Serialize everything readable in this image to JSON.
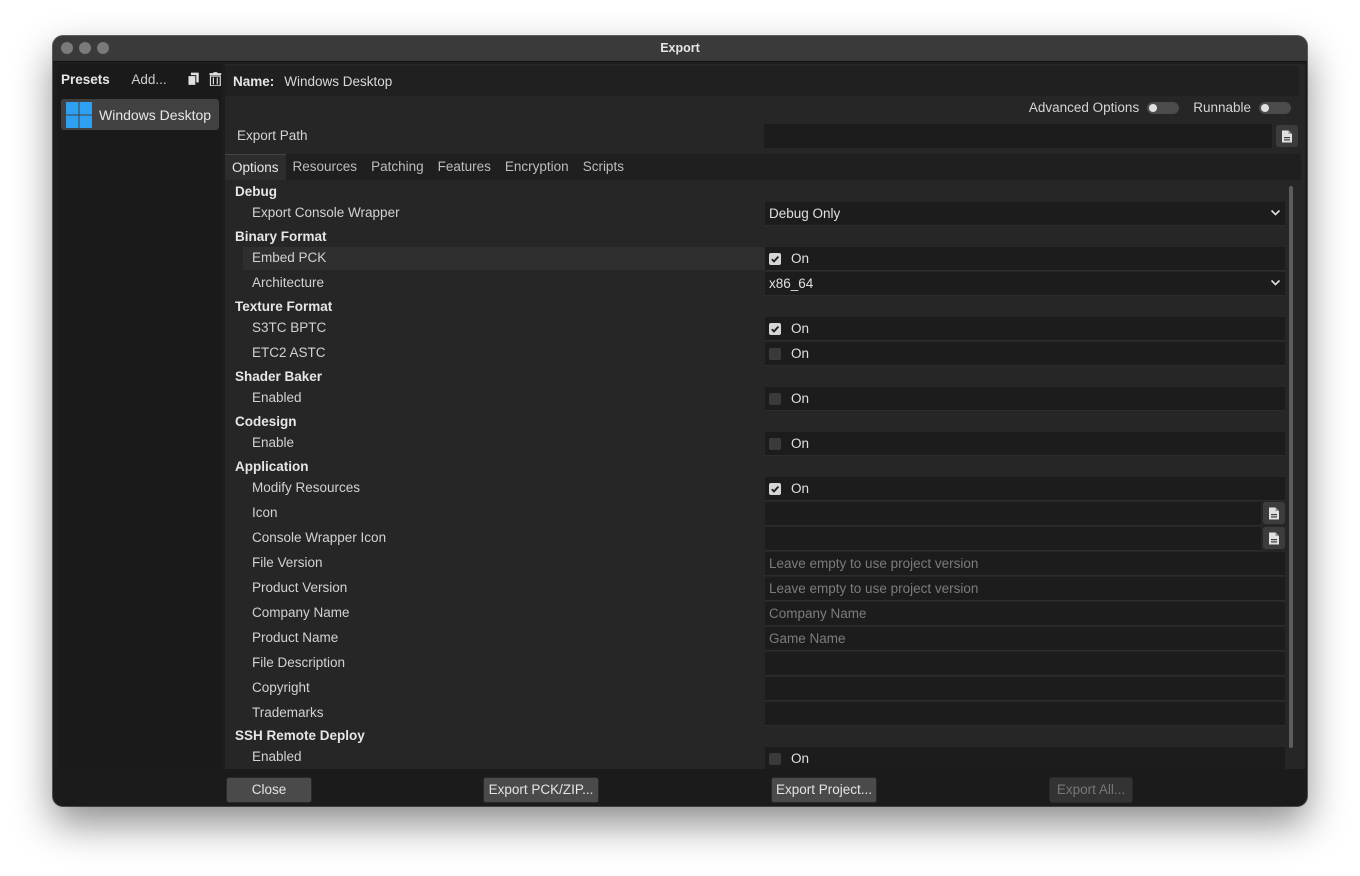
{
  "window": {
    "title": "Export"
  },
  "sidebar": {
    "title": "Presets",
    "add_label": "Add...",
    "items": [
      {
        "label": "Windows Desktop",
        "icon": "windows-logo-icon"
      }
    ]
  },
  "name_bar": {
    "label": "Name:",
    "value": "Windows Desktop"
  },
  "toggles": {
    "advanced_options": {
      "label": "Advanced Options",
      "on": false
    },
    "runnable": {
      "label": "Runnable",
      "on": false
    }
  },
  "export_path": {
    "label": "Export Path",
    "value": ""
  },
  "tabs": [
    "Options",
    "Resources",
    "Patching",
    "Features",
    "Encryption",
    "Scripts"
  ],
  "active_tab": "Options",
  "options": {
    "debug": {
      "title": "Debug",
      "export_console_wrapper": {
        "label": "Export Console Wrapper",
        "value": "Debug Only"
      }
    },
    "binary_format": {
      "title": "Binary Format",
      "embed_pck": {
        "label": "Embed PCK",
        "checked": true,
        "text": "On"
      },
      "architecture": {
        "label": "Architecture",
        "value": "x86_64"
      }
    },
    "texture_format": {
      "title": "Texture Format",
      "s3tc_bptc": {
        "label": "S3TC BPTC",
        "checked": true,
        "text": "On"
      },
      "etc2_astc": {
        "label": "ETC2 ASTC",
        "checked": false,
        "text": "On"
      }
    },
    "shader_baker": {
      "title": "Shader Baker",
      "enabled": {
        "label": "Enabled",
        "checked": false,
        "text": "On"
      }
    },
    "codesign": {
      "title": "Codesign",
      "enable": {
        "label": "Enable",
        "checked": false,
        "text": "On"
      }
    },
    "application": {
      "title": "Application",
      "modify_resources": {
        "label": "Modify Resources",
        "checked": true,
        "text": "On"
      },
      "icon": {
        "label": "Icon",
        "value": ""
      },
      "console_wrapper_icon": {
        "label": "Console Wrapper Icon",
        "value": ""
      },
      "file_version": {
        "label": "File Version",
        "placeholder": "Leave empty to use project version"
      },
      "product_version": {
        "label": "Product Version",
        "placeholder": "Leave empty to use project version"
      },
      "company_name": {
        "label": "Company Name",
        "placeholder": "Company Name"
      },
      "product_name": {
        "label": "Product Name",
        "placeholder": "Game Name"
      },
      "file_description": {
        "label": "File Description",
        "value": ""
      },
      "copyright": {
        "label": "Copyright",
        "value": ""
      },
      "trademarks": {
        "label": "Trademarks",
        "value": ""
      }
    },
    "ssh_remote_deploy": {
      "title": "SSH Remote Deploy",
      "enabled": {
        "label": "Enabled",
        "checked": false,
        "text": "On"
      }
    }
  },
  "footer": {
    "close": "Close",
    "export_pck_zip": "Export PCK/ZIP...",
    "export_project": "Export Project...",
    "export_all": "Export All..."
  }
}
